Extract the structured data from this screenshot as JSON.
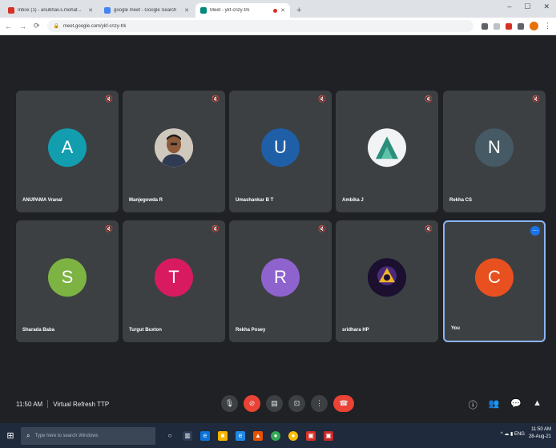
{
  "browser": {
    "tabs": [
      {
        "title": "Inbox (1) - anubhav.s.mohat...",
        "favicon_color": "#d93025",
        "active": false
      },
      {
        "title": "google meet - Google Search",
        "favicon_color": "#4285f4",
        "active": false
      },
      {
        "title": "Meet - ykf-cnzy-trk",
        "favicon_color": "#00897b",
        "active": true,
        "recording": true
      }
    ],
    "new_tab": "+",
    "window_controls": {
      "minimize": "–",
      "maximize": "☐",
      "close": "✕"
    },
    "address": "meet.google.com/ykf-cnzy-trk"
  },
  "tiles": [
    {
      "name": "ANUPAMA Vranal",
      "initial": "A",
      "color": "#129eaf",
      "kind": "letter",
      "mic": "🔇"
    },
    {
      "name": "Manjegowda R",
      "initial": "",
      "color": "",
      "kind": "photo",
      "mic": "🔇"
    },
    {
      "name": "Umashankar B T",
      "initial": "U",
      "color": "#1e5fa8",
      "kind": "letter",
      "mic": "🔇"
    },
    {
      "name": "Ambika J",
      "initial": "A",
      "color": "#f1f3f4",
      "kind": "logo",
      "mic": "🔇"
    },
    {
      "name": "Rekha CS",
      "initial": "N",
      "color": "#455a64",
      "kind": "letter",
      "mic": "🔇"
    },
    {
      "name": "Sharada Baba",
      "initial": "S",
      "color": "#7cb342",
      "kind": "letter",
      "mic": "🔇"
    },
    {
      "name": "Turgut Buxton",
      "initial": "T",
      "color": "#d81b60",
      "kind": "letter",
      "mic": "🔇"
    },
    {
      "name": "Rekha Posey",
      "initial": "R",
      "color": "#8e63ce",
      "kind": "letter",
      "mic": "🔇"
    },
    {
      "name": "sridhara HP",
      "initial": "",
      "color": "#1b1030",
      "kind": "dark-logo",
      "mic": "🔇"
    },
    {
      "name": "You",
      "initial": "C",
      "color": "#e8501f",
      "kind": "letter",
      "self": true
    }
  ],
  "meeting": {
    "time": "11:50 AM",
    "title": "Virtual Refresh TTP"
  },
  "controls": {
    "mic": "🎙",
    "cam": "⊘",
    "captions": "▤",
    "present": "⊡",
    "more": "⋮",
    "end": "☎"
  },
  "right_controls": [
    "ⓘ",
    "👥",
    "💬",
    "▲"
  ],
  "taskbar": {
    "start": "⊞",
    "search_placeholder": "Type here to search Windows",
    "apps": [
      {
        "icon": "○",
        "color": "transparent"
      },
      {
        "icon": "▥",
        "color": "#2b3a55"
      },
      {
        "icon": "e",
        "color": "#0a74da"
      },
      {
        "icon": "■",
        "color": "#f5b400"
      },
      {
        "icon": "e",
        "color": "#1e88e5"
      },
      {
        "icon": "▲",
        "color": "#e65100"
      },
      {
        "icon": "●",
        "color": "#34a853"
      },
      {
        "icon": "●",
        "color": "#fbbc04"
      },
      {
        "icon": "▣",
        "color": "#d93025"
      },
      {
        "icon": "▣",
        "color": "#c62828"
      }
    ],
    "tray": "^ ☁ ▮ ENG",
    "clock_time": "11:50 AM",
    "clock_date": "28-Aug-21"
  }
}
